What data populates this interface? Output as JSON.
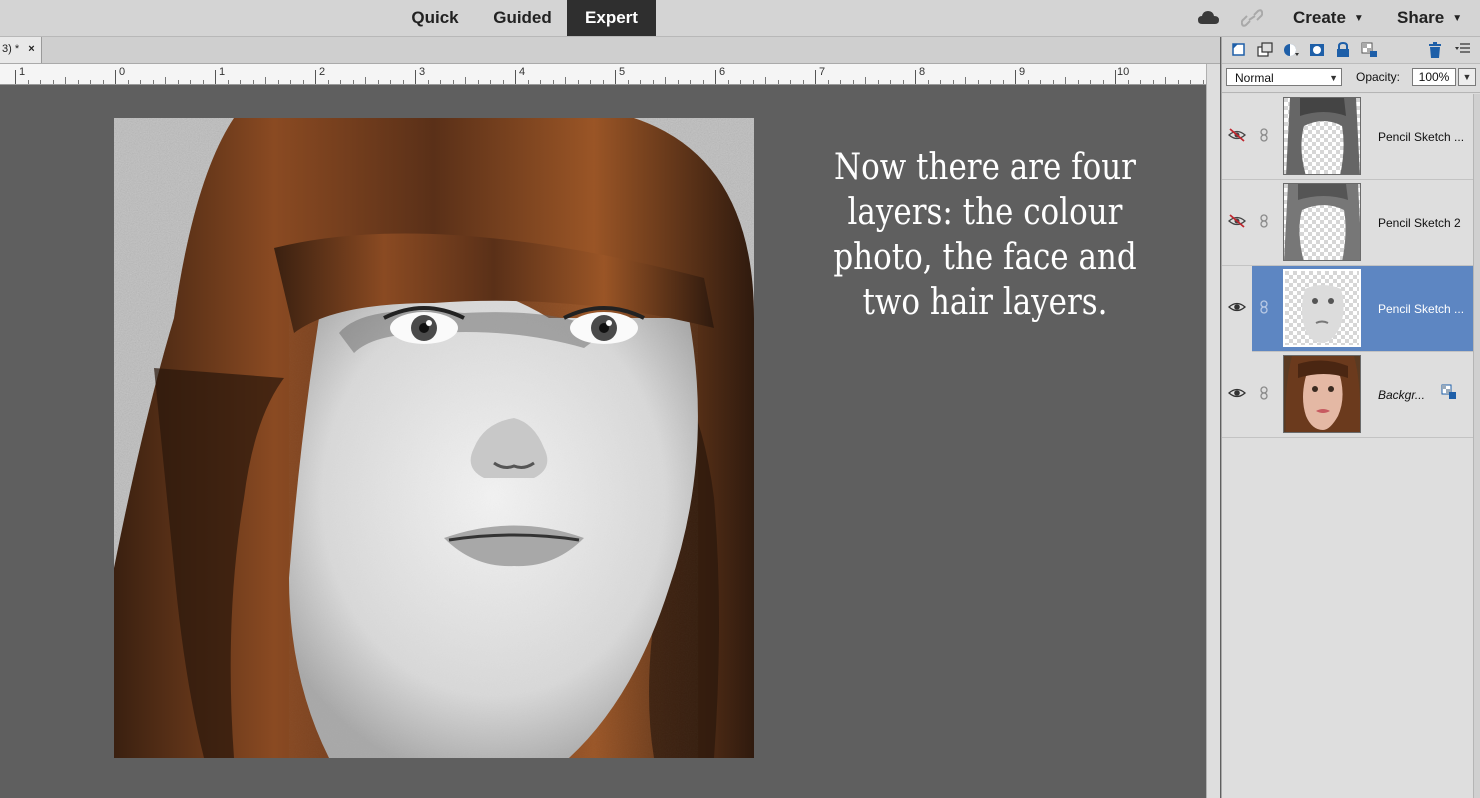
{
  "modes": [
    {
      "label": "Quick",
      "active": false
    },
    {
      "label": "Guided",
      "active": false
    },
    {
      "label": "Expert",
      "active": true
    }
  ],
  "topbar": {
    "create_label": "Create",
    "share_label": "Share"
  },
  "document_tab": {
    "title": "3) *",
    "close_glyph": "×"
  },
  "ruler": {
    "labels": [
      "1",
      "0",
      "1",
      "2",
      "3",
      "4",
      "5",
      "6",
      "7",
      "8",
      "9",
      "10"
    ]
  },
  "canvas": {
    "caption": "Now there are four layers: the colour photo, the face and two hair layers."
  },
  "layers_panel": {
    "blend_mode": "Normal",
    "opacity_label": "Opacity:",
    "opacity_value": "100%",
    "layers": [
      {
        "name": "Pencil Sketch ...",
        "visible": false,
        "selected": false
      },
      {
        "name": "Pencil Sketch 2",
        "visible": false,
        "selected": false
      },
      {
        "name": "Pencil Sketch ...",
        "visible": true,
        "selected": true
      },
      {
        "name": "Backgr...",
        "visible": true,
        "selected": false,
        "locked": true
      }
    ]
  },
  "colors": {
    "accent_selected": "#5d86c2",
    "mode_active_bg": "#2f2f2f",
    "canvas_bg": "#5f5f5f"
  }
}
